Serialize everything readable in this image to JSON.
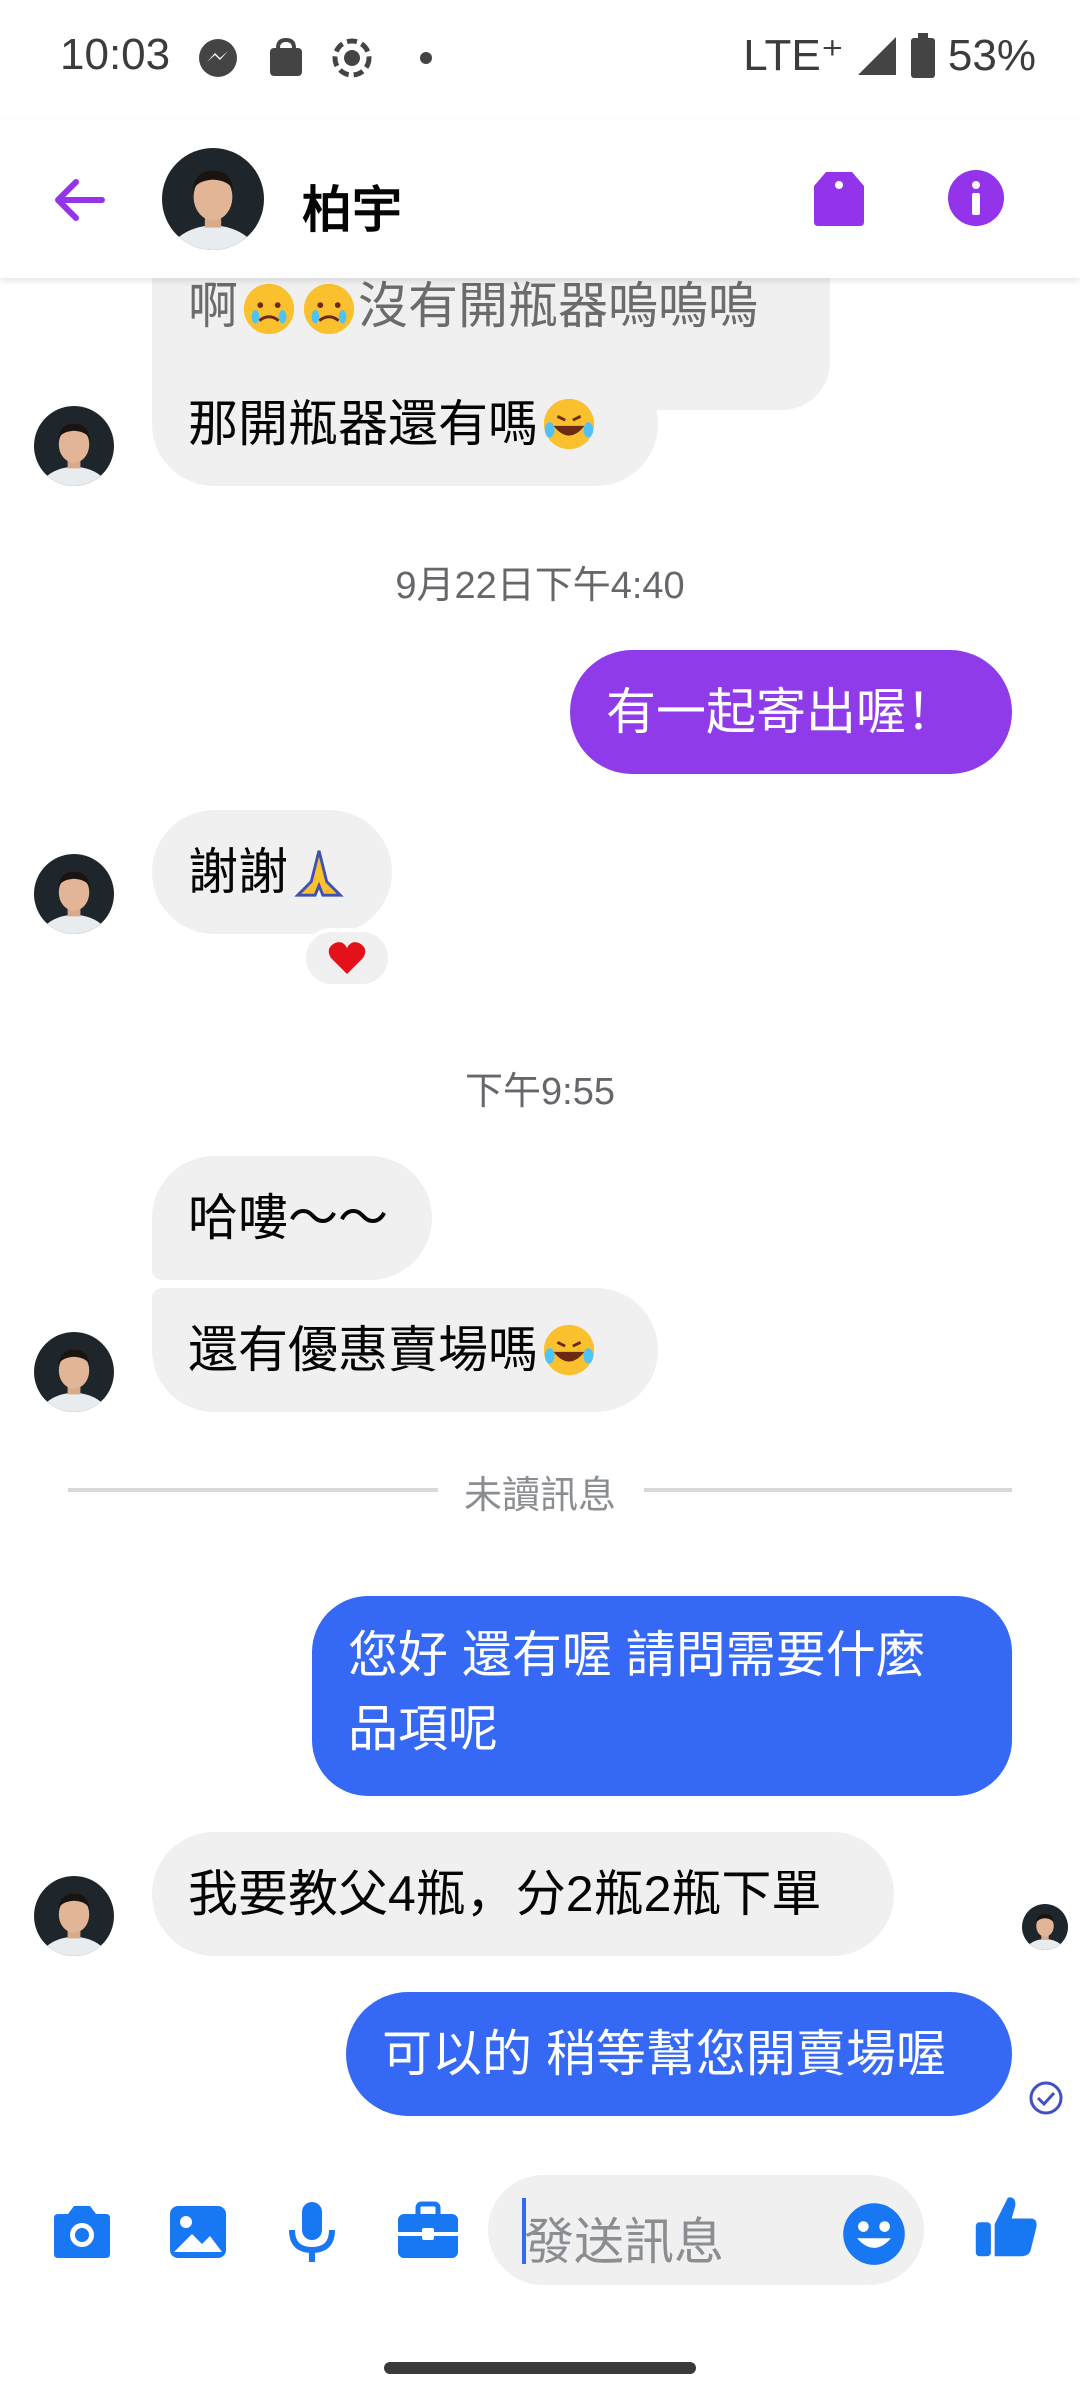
{
  "status_bar": {
    "time": "10:03",
    "network": "LTE⁺",
    "battery": "53%"
  },
  "header": {
    "contact_name": "柏宇",
    "accent_color": "#9333ea"
  },
  "messages": {
    "partial_top": "啊",
    "partial_top_tail": "沒有開瓶器嗚嗚嗚",
    "m1": "那開瓶器還有嗎",
    "ts1": "9月22日下午4:40",
    "m2": "有一起寄出喔！",
    "m3": "謝謝",
    "ts2": "下午9:55",
    "m4": "哈嘍～～",
    "m5": "還有優惠賣場嗎",
    "unread_divider": "未讀訊息",
    "m6_line1": "您好 還有喔 請問需要什麼",
    "m6_line2": "品項呢",
    "m7": "我要教父4瓶，分2瓶2瓶下單",
    "m8": "可以的 稍等幫您開賣場喔"
  },
  "composer": {
    "placeholder": "發送訊息"
  },
  "colors": {
    "purple_bubble": "#8f3bea",
    "blue_bubble": "#3468f5",
    "incoming_bubble": "#f0f0f0",
    "icon_blue": "#1877f2"
  },
  "icons": [
    "back-arrow-icon",
    "tag-icon",
    "info-icon",
    "camera-icon",
    "photo-icon",
    "microphone-icon",
    "briefcase-icon",
    "smiley-icon",
    "thumbs-up-icon",
    "heart-icon",
    "folded-hands-icon",
    "laughing-icon",
    "sad-face-icon",
    "read-receipt-icon"
  ]
}
